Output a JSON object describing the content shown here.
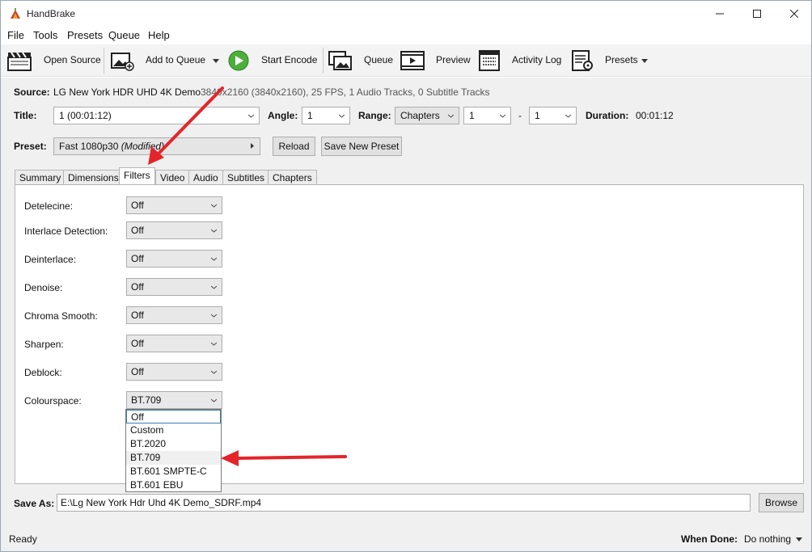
{
  "window": {
    "title": "HandBrake"
  },
  "menu": [
    "File",
    "Tools",
    "Presets",
    "Queue",
    "Help"
  ],
  "toolbar": {
    "open_source": "Open Source",
    "add_to_queue": "Add to Queue",
    "start_encode": "Start Encode",
    "queue": "Queue",
    "preview": "Preview",
    "activity_log": "Activity Log",
    "presets": "Presets"
  },
  "source": {
    "label": "Source:",
    "name": "LG New York HDR UHD 4K Demo",
    "info": "3840x2160 (3840x2160), 25 FPS, 1 Audio Tracks, 0 Subtitle Tracks"
  },
  "title_row": {
    "title_label": "Title:",
    "title_value": "1  (00:01:12)",
    "angle_label": "Angle:",
    "angle_value": "1",
    "range_label": "Range:",
    "range_mode": "Chapters",
    "range_start": "1",
    "range_dash": "-",
    "range_end": "1",
    "duration_label": "Duration:",
    "duration_value": "00:01:12"
  },
  "preset": {
    "label": "Preset:",
    "name": "Fast 1080p30",
    "modified": "(Modified)",
    "reload": "Reload",
    "save_new": "Save New Preset"
  },
  "tabs": [
    "Summary",
    "Dimensions",
    "Filters",
    "Video",
    "Audio",
    "Subtitles",
    "Chapters"
  ],
  "active_tab": "Filters",
  "filters": [
    {
      "label": "Detelecine:",
      "value": "Off"
    },
    {
      "label": "Interlace Detection:",
      "value": "Off"
    },
    {
      "label": "Deinterlace:",
      "value": "Off"
    },
    {
      "label": "Denoise:",
      "value": "Off"
    },
    {
      "label": "Chroma Smooth:",
      "value": "Off"
    },
    {
      "label": "Sharpen:",
      "value": "Off"
    },
    {
      "label": "Deblock:",
      "value": "Off"
    },
    {
      "label": "Colourspace:",
      "value": "BT.709"
    }
  ],
  "colourspace_options": [
    "Off",
    "Custom",
    "BT.2020",
    "BT.709",
    "BT.601 SMPTE-C",
    "BT.601 EBU"
  ],
  "save_as": {
    "label": "Save As:",
    "path": "E:\\Lg New York Hdr Uhd 4K Demo_SDRF.mp4",
    "browse": "Browse"
  },
  "status": {
    "text": "Ready",
    "when_done_label": "When Done:",
    "when_done_value": "Do nothing"
  },
  "colors": {
    "annotation_arrow": "#e3252a",
    "start_green": "#4caf3a"
  }
}
